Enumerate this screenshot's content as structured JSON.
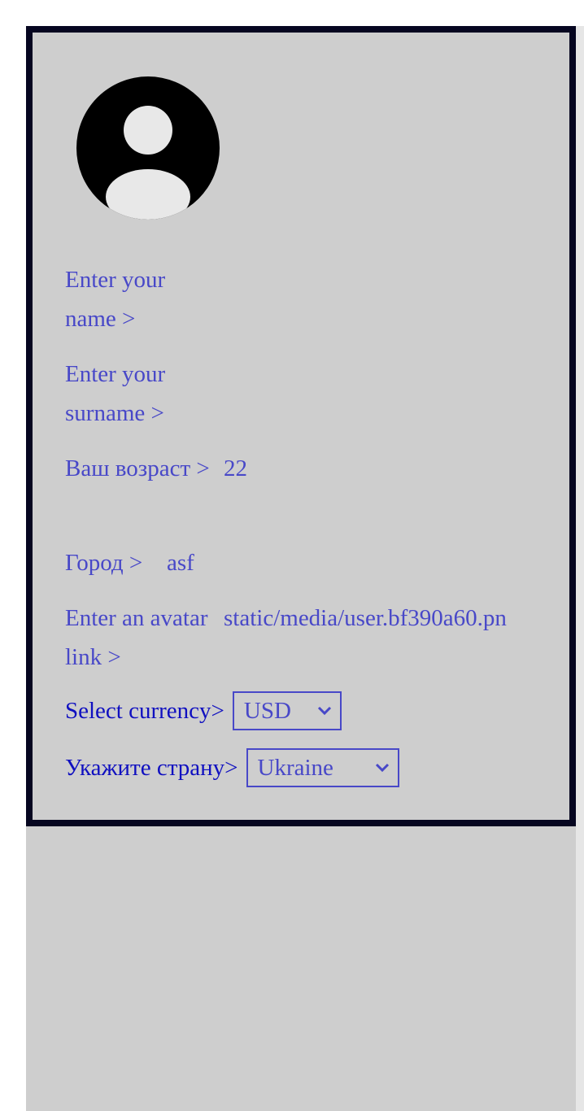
{
  "profile": {
    "avatar_icon": "user-avatar-icon",
    "name": {
      "label": "Enter your name >",
      "value": ""
    },
    "surname": {
      "label": "Enter your surname >",
      "value": ""
    },
    "age": {
      "label": "Ваш возраст >",
      "value": "22"
    },
    "city": {
      "label": "Город >",
      "value": "asf"
    },
    "avatar_link": {
      "label": "Enter an avatar link >",
      "value": "static/media/user.bf390a60.pn"
    },
    "currency": {
      "label": "Select currency>",
      "selected": "USD"
    },
    "country": {
      "label": "Укажите страну>",
      "selected": "Ukraine"
    }
  },
  "colors": {
    "background": "#cecece",
    "border": "#060620",
    "text": "#4848c8",
    "label_dark": "#1010c0"
  }
}
